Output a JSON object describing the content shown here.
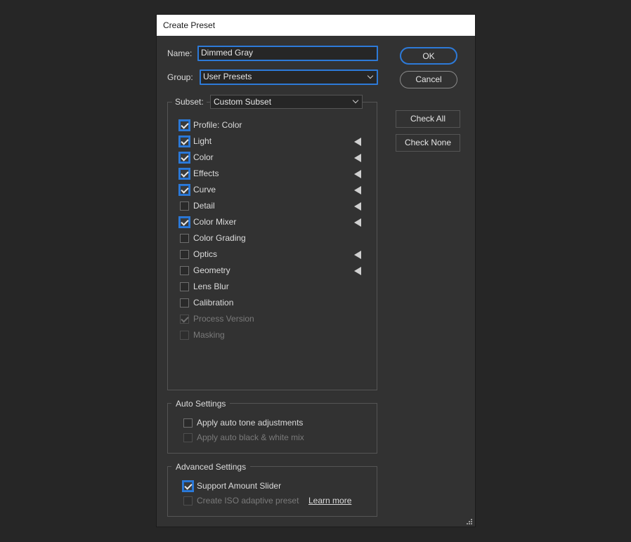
{
  "dialog": {
    "title": "Create Preset",
    "name_label": "Name:",
    "name_value": "Dimmed Gray",
    "group_label": "Group:",
    "group_value": "User Presets",
    "ok_label": "OK",
    "cancel_label": "Cancel",
    "check_all_label": "Check All",
    "check_none_label": "Check None"
  },
  "subset": {
    "label": "Subset:",
    "value": "Custom Subset",
    "items": [
      {
        "label": "Profile: Color",
        "checked": true,
        "disabled": false,
        "arrow": false
      },
      {
        "label": "Light",
        "checked": true,
        "disabled": false,
        "arrow": true
      },
      {
        "label": "Color",
        "checked": true,
        "disabled": false,
        "arrow": true
      },
      {
        "label": "Effects",
        "checked": true,
        "disabled": false,
        "arrow": true
      },
      {
        "label": "Curve",
        "checked": true,
        "disabled": false,
        "arrow": true
      },
      {
        "label": "Detail",
        "checked": false,
        "disabled": false,
        "arrow": true
      },
      {
        "label": "Color Mixer",
        "checked": true,
        "disabled": false,
        "arrow": true
      },
      {
        "label": "Color Grading",
        "checked": false,
        "disabled": false,
        "arrow": false
      },
      {
        "label": "Optics",
        "checked": false,
        "disabled": false,
        "arrow": true
      },
      {
        "label": "Geometry",
        "checked": false,
        "disabled": false,
        "arrow": true
      },
      {
        "label": "Lens Blur",
        "checked": false,
        "disabled": false,
        "arrow": false
      },
      {
        "label": "Calibration",
        "checked": false,
        "disabled": false,
        "arrow": false
      },
      {
        "label": "Process Version",
        "checked": true,
        "disabled": true,
        "arrow": false
      },
      {
        "label": "Masking",
        "checked": false,
        "disabled": true,
        "arrow": false
      }
    ]
  },
  "auto_settings": {
    "title": "Auto Settings",
    "tone_label": "Apply auto tone adjustments",
    "bw_label": "Apply auto black & white mix"
  },
  "advanced_settings": {
    "title": "Advanced Settings",
    "amount_label": "Support Amount Slider",
    "iso_label": "Create ISO adaptive preset",
    "learn_more": "Learn more"
  },
  "colors": {
    "accent": "#2d7ad8",
    "background": "#323232",
    "outer": "#262626"
  }
}
